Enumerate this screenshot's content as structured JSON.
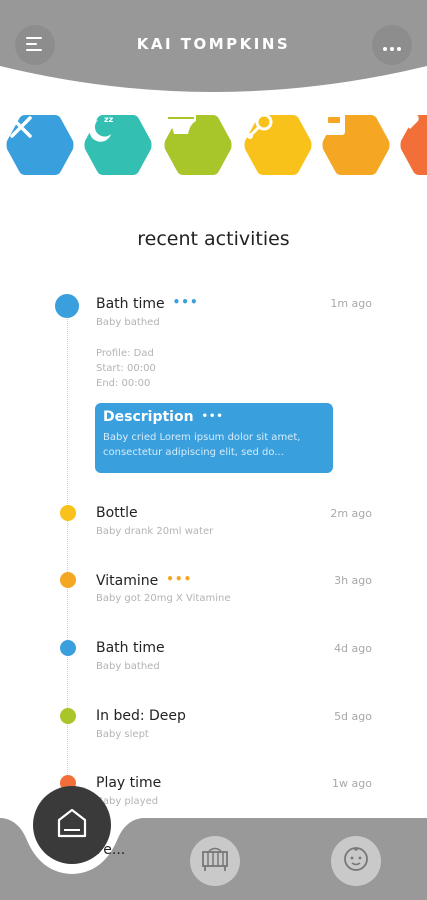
{
  "header": {
    "title": "KAI TOMPKINS",
    "menu_icon": "menu-icon",
    "more_icon": "more-icon"
  },
  "categories": [
    {
      "name": "feeding",
      "icon": "cutlery-icon",
      "color": "#3a9fdd"
    },
    {
      "name": "sleep",
      "icon": "moon-icon",
      "color": "#33bfb2"
    },
    {
      "name": "diaper",
      "icon": "diaper-icon",
      "color": "#a8c52a"
    },
    {
      "name": "play",
      "icon": "rattle-icon",
      "color": "#f8c21b"
    },
    {
      "name": "weight",
      "icon": "scale-icon",
      "color": "#f5a623"
    },
    {
      "name": "health",
      "icon": "heart-icon",
      "color": "#f26f3a"
    }
  ],
  "section_title": "recent activities",
  "activities": [
    {
      "title": "Bath time",
      "subtitle": "Baby bathed",
      "time": "1m ago",
      "color": "#3a9fdd"
    },
    {
      "title": "Bottle",
      "subtitle": "Baby drank 20ml water",
      "time": "2m ago",
      "color": "#f8c21b"
    },
    {
      "title": "Vitamine",
      "subtitle": "Baby got 20mg X Vitamine",
      "time": "3h ago",
      "color": "#f5a623"
    },
    {
      "title": "Bath time",
      "subtitle": "Baby bathed",
      "time": "4d ago",
      "color": "#3a9fdd"
    },
    {
      "title": "In bed: Deep",
      "subtitle": "Baby slept",
      "time": "5d ago",
      "color": "#a8c52a"
    },
    {
      "title": "Play time",
      "subtitle": "Baby played",
      "time": "1w ago",
      "color": "#f26f3a"
    },
    {
      "title": "Fe..."
    }
  ],
  "details": {
    "profile": "Profile: Dad",
    "start": "Start: 00:00",
    "end": "End: 00:00"
  },
  "description": {
    "title": "Description",
    "text": "Baby cried Lorem ipsum dolor sit amet, consectetur adipiscing elit, sed do..."
  },
  "more_dots": "•••",
  "bottom_nav": {
    "home_icon": "home-icon",
    "crib_icon": "crib-icon",
    "baby_icon": "baby-face-icon"
  }
}
